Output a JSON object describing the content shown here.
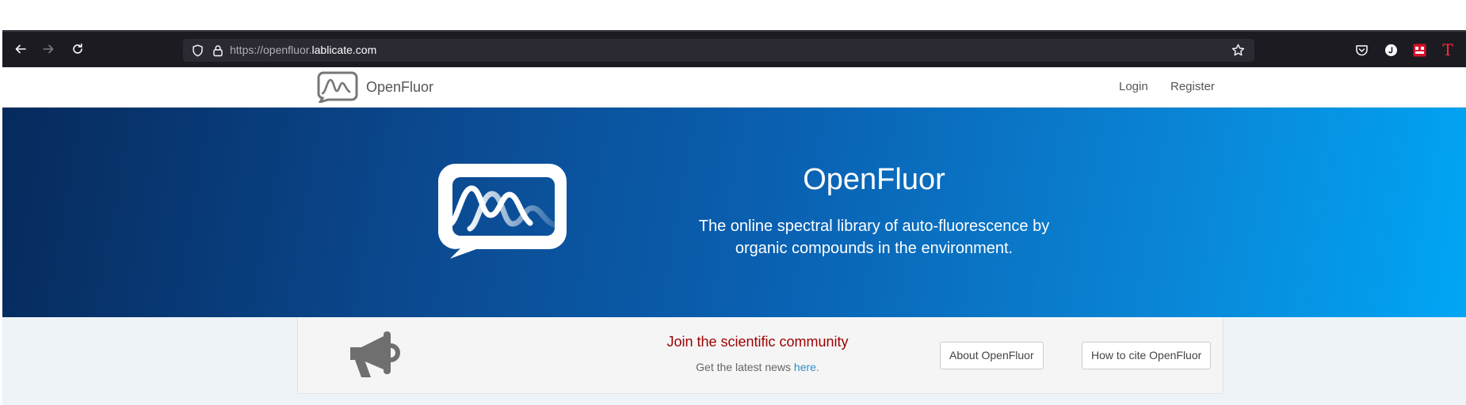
{
  "browser": {
    "url_prefix": "https://openfluor.",
    "url_host": "lablicate.com",
    "icons": [
      "back-arrow-icon",
      "forward-arrow-icon",
      "reload-icon",
      "shield-icon",
      "lock-icon",
      "star-bookmark-icon",
      "pocket-icon",
      "account-icon",
      "extension-icon",
      "text-extension-icon"
    ],
    "ext_text_icon_glyph": "T"
  },
  "navbar": {
    "brand_name": "OpenFluor",
    "links": [
      "Login",
      "Register"
    ]
  },
  "hero": {
    "title": "OpenFluor",
    "subtitle_line1": "The online spectral library of auto-fluorescence by",
    "subtitle_line2": "organic compounds in the environment."
  },
  "community": {
    "title": "Join the scientific community",
    "text": "Get the latest news ",
    "link_text": "here.",
    "buttons": [
      "About OpenFluor",
      "How to cite OpenFluor"
    ]
  },
  "colors": {
    "browser_bar": "#1c1b22",
    "url_field": "#2b2a33",
    "hero_start": "#062a5c",
    "hero_end": "#00a6f5",
    "join_title": "#9b0000",
    "link": "#2a8fcc",
    "strip_bg": "#edf3f7"
  }
}
